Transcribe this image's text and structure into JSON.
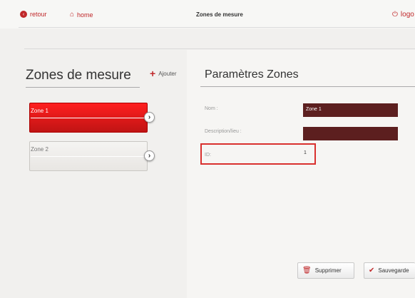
{
  "nav": {
    "back_label": "retour",
    "home_label": "home",
    "page_title": "Zones de mesure",
    "logout_label": "logo"
  },
  "left": {
    "title": "Zones de mesure",
    "add_label": "Ajouter",
    "zones": [
      {
        "label": "Zone 1",
        "active": true
      },
      {
        "label": "Zone 2",
        "active": false
      }
    ]
  },
  "right": {
    "title": "Paramètres Zones",
    "fields": {
      "name_label": "Nom :",
      "name_value": "Zone 1",
      "description_label": "Description/lieu :",
      "description_value": "",
      "id_label": "ID:",
      "id_value": "1"
    },
    "buttons": {
      "delete_label": "Supprimer",
      "save_label": "Sauvegarde"
    }
  },
  "colors": {
    "accent": "#c0282a",
    "active_zone": "#e61919",
    "input_bg": "#5c1f1f",
    "highlight_border": "#d9302e"
  },
  "icons": [
    "back-circle-icon",
    "home-icon",
    "power-icon",
    "plus-icon",
    "chevron-right-icon",
    "trash-icon",
    "check-icon"
  ]
}
